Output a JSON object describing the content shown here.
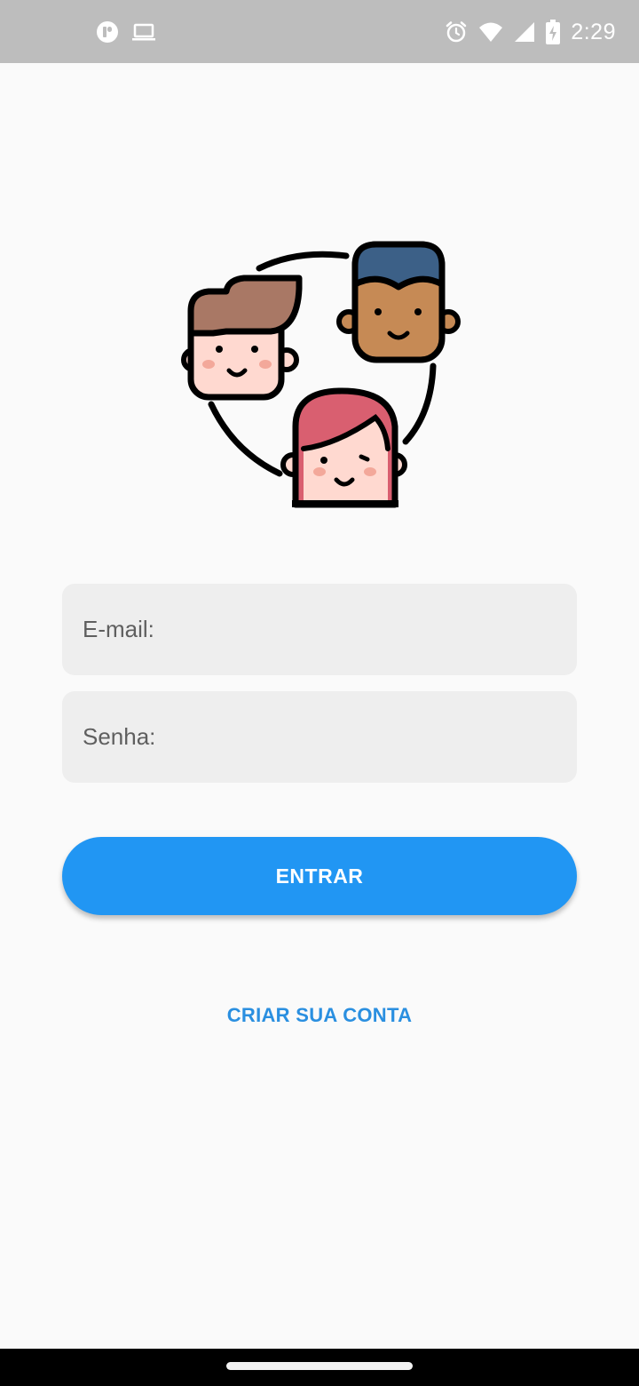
{
  "status_bar": {
    "time": "2:29",
    "background": "#bdbdbd",
    "left_icons": [
      "app-notification-icon",
      "laptop-icon"
    ],
    "right_icons": [
      "alarm-icon",
      "wifi-icon",
      "cellular-signal-icon",
      "battery-charging-icon"
    ]
  },
  "illustration": {
    "name": "people-group-illustration"
  },
  "form": {
    "email": {
      "placeholder": "E-mail:",
      "value": ""
    },
    "password": {
      "placeholder": "Senha:",
      "value": ""
    }
  },
  "actions": {
    "login_label": "ENTRAR",
    "create_account_label": "CRIAR SUA CONTA"
  },
  "colors": {
    "background": "#fafafa",
    "field_background": "#eeeeee",
    "accent": "#2196f3",
    "link": "#2a8fe0"
  }
}
